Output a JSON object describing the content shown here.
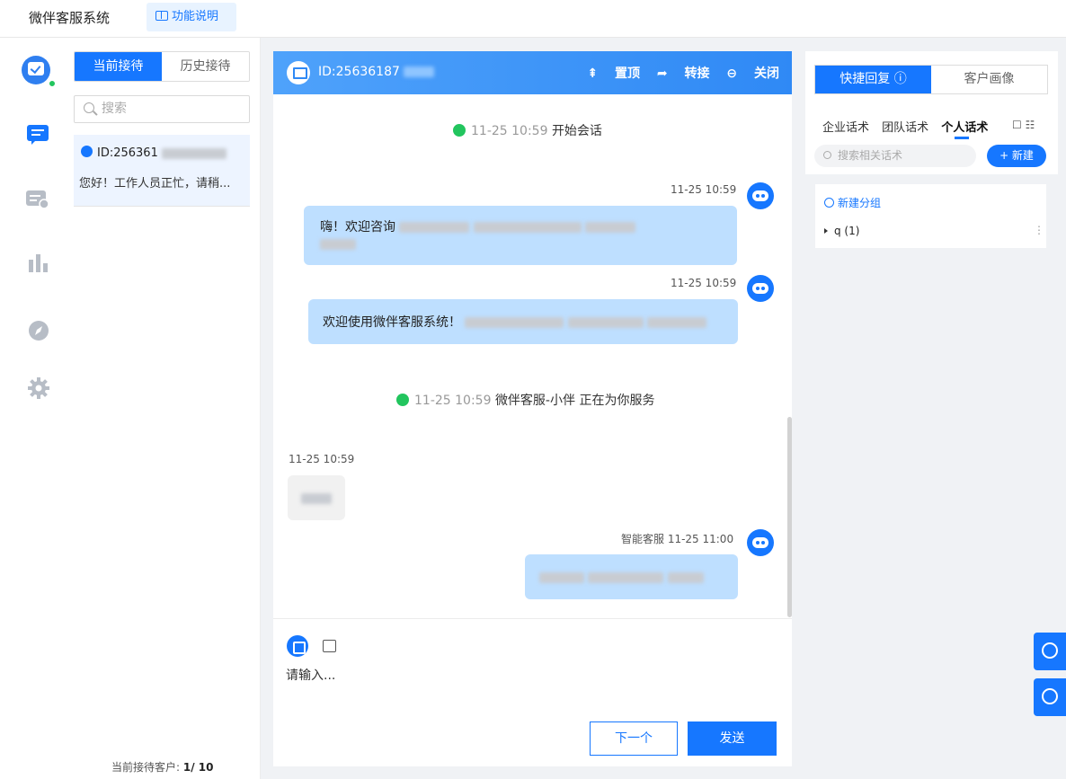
{
  "header": {
    "title": "微伴客服系统",
    "help_label": "功能说明"
  },
  "conversations": {
    "tab_current": "当前接待",
    "tab_history": "历史接待",
    "search_placeholder": "搜索",
    "item": {
      "id": "ID:256361",
      "preview": "您好！工作人员正忙，请稍..."
    },
    "footer_label": "当前接待客户:",
    "footer_count": "1/ 10"
  },
  "chat": {
    "customer_id": "ID:25636187",
    "actions": {
      "pin": "置顶",
      "transfer": "转接",
      "close": "关闭"
    },
    "system1": {
      "time": "11-25 10:59",
      "text": "开始会话"
    },
    "msg1": {
      "time": "11-25 10:59",
      "text": "嗨！欢迎咨询"
    },
    "msg2": {
      "time": "11-25 10:59",
      "text": "欢迎使用微伴客服系统！"
    },
    "system2": {
      "time": "11-25 10:59",
      "text": "微伴客服-小伴 正在为你服务"
    },
    "msg3": {
      "time": "11-25 10:59"
    },
    "msg4": {
      "time": "智能客服 11-25 11:00"
    },
    "input_placeholder": "请输入...",
    "next_label": "下一个",
    "send_label": "发送"
  },
  "side": {
    "tab_quick": "快捷回复",
    "tab_profile": "客户画像",
    "subtabs": [
      "企业话术",
      "团队话术",
      "个人话术"
    ],
    "search_placeholder": "搜索相关话术",
    "new_label": "+ 新建",
    "new_group": "新建分组",
    "group": "q (1)"
  },
  "accent_color": "#1677ff"
}
